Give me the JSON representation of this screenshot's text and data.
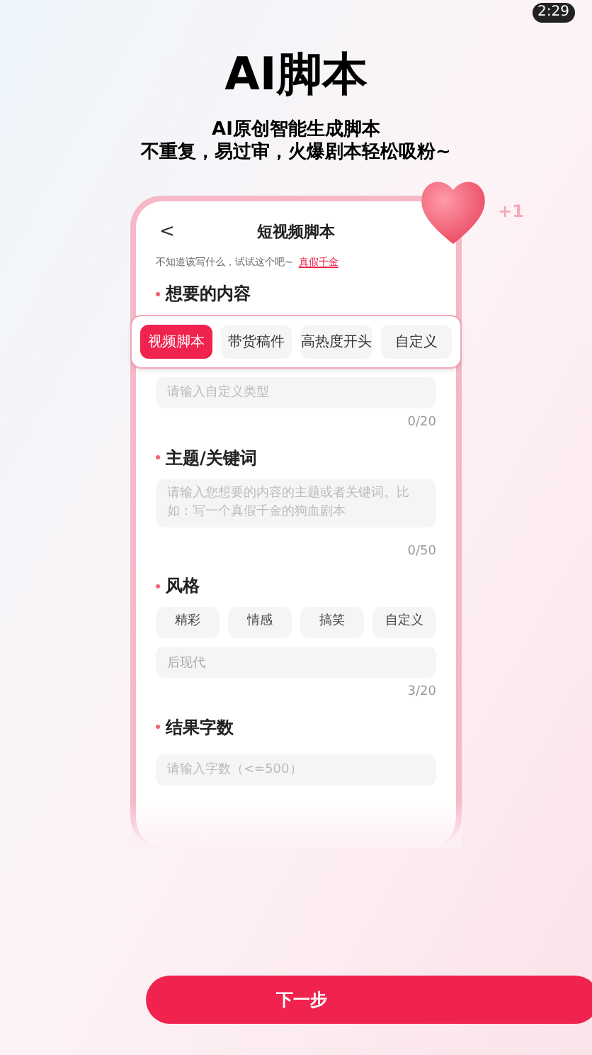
{
  "status_bar": {
    "time": "2:29"
  },
  "hero": {
    "title": "AI脚本",
    "subtitle_lines": [
      "AI原创智能生成脚本",
      "不重复，易过审，火爆剧本轻松吸粉~"
    ],
    "badge": "+1"
  },
  "card": {
    "back": "<",
    "title": "短视频脚本",
    "hint": "不知道该写什么，试试这个吧~",
    "hint_link": "真假千金",
    "sections": [
      {
        "kind": "types",
        "label": "想要的内容",
        "tabs": [
          {
            "label": "视频脚本",
            "selected": true
          },
          {
            "label": "带货稿件",
            "selected": false
          },
          {
            "label": "高热度开头",
            "selected": false
          },
          {
            "label": "自定义",
            "selected": false
          }
        ],
        "placeholder": "请输入自定义类型",
        "counter": "0/20"
      },
      {
        "kind": "textarea",
        "label": "主题/关键词",
        "placeholder": "请输入您想要的内容的主题或者关键词。比如：写一个真假千金的狗血剧本",
        "counter": "0/50"
      },
      {
        "kind": "options",
        "label": "风格",
        "options": [
          "精彩",
          "情感",
          "搞笑",
          "自定义"
        ],
        "value": "后现代",
        "counter": "3/20"
      },
      {
        "kind": "input",
        "label": "结果字数",
        "placeholder": "请输入字数（<=500）"
      }
    ]
  },
  "next_button": "下一步"
}
